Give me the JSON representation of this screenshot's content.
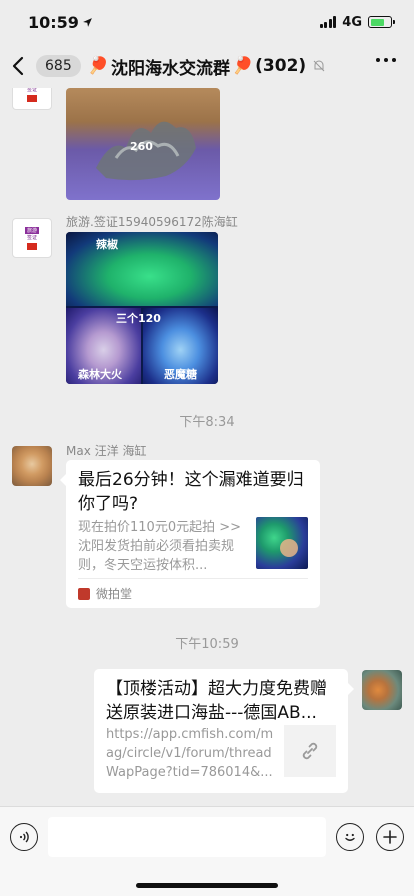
{
  "status_bar": {
    "time": "10:59",
    "network": "4G"
  },
  "nav": {
    "back_count": "685",
    "title": "沈阳海水交流群",
    "member_count": "(302)",
    "title_emoji": "🏓"
  },
  "messages": {
    "msg2_sender": "旅游.签证15940596172陈海缸",
    "photo1_caption": "260",
    "photo2_label_top": "辣椒",
    "photo2_label_mid": "三个120",
    "photo2_label_left": "森林大火",
    "photo2_label_right": "恶魔糖",
    "time1": "下午8:34",
    "msg3_sender": "Max 汪洋 海缸",
    "card1_title": "最后26分钟！这个漏难道要归你了吗?",
    "card1_desc": "现在拍价110元0元起拍 >> 沈阳发货拍前必须看拍卖规则，冬天空运按体积...",
    "card1_source": "微拍堂",
    "time2": "下午10:59",
    "card2_title": "【顶楼活动】超大力度免费赠送原装进口海盐---德国AB...",
    "card2_desc": "https://app.cmfish.com/mag/circle/v1/forum/threadWapPage?tid=786014&..."
  },
  "icons": [
    "location-arrow-icon",
    "signal-icon",
    "battery-icon",
    "back-chevron-icon",
    "mute-bell-icon",
    "more-icon",
    "link-icon",
    "voice-icon",
    "emoji-icon",
    "add-icon"
  ],
  "colors": {
    "background": "#ededed",
    "bubble": "#ffffff",
    "battery": "#4cd964"
  }
}
